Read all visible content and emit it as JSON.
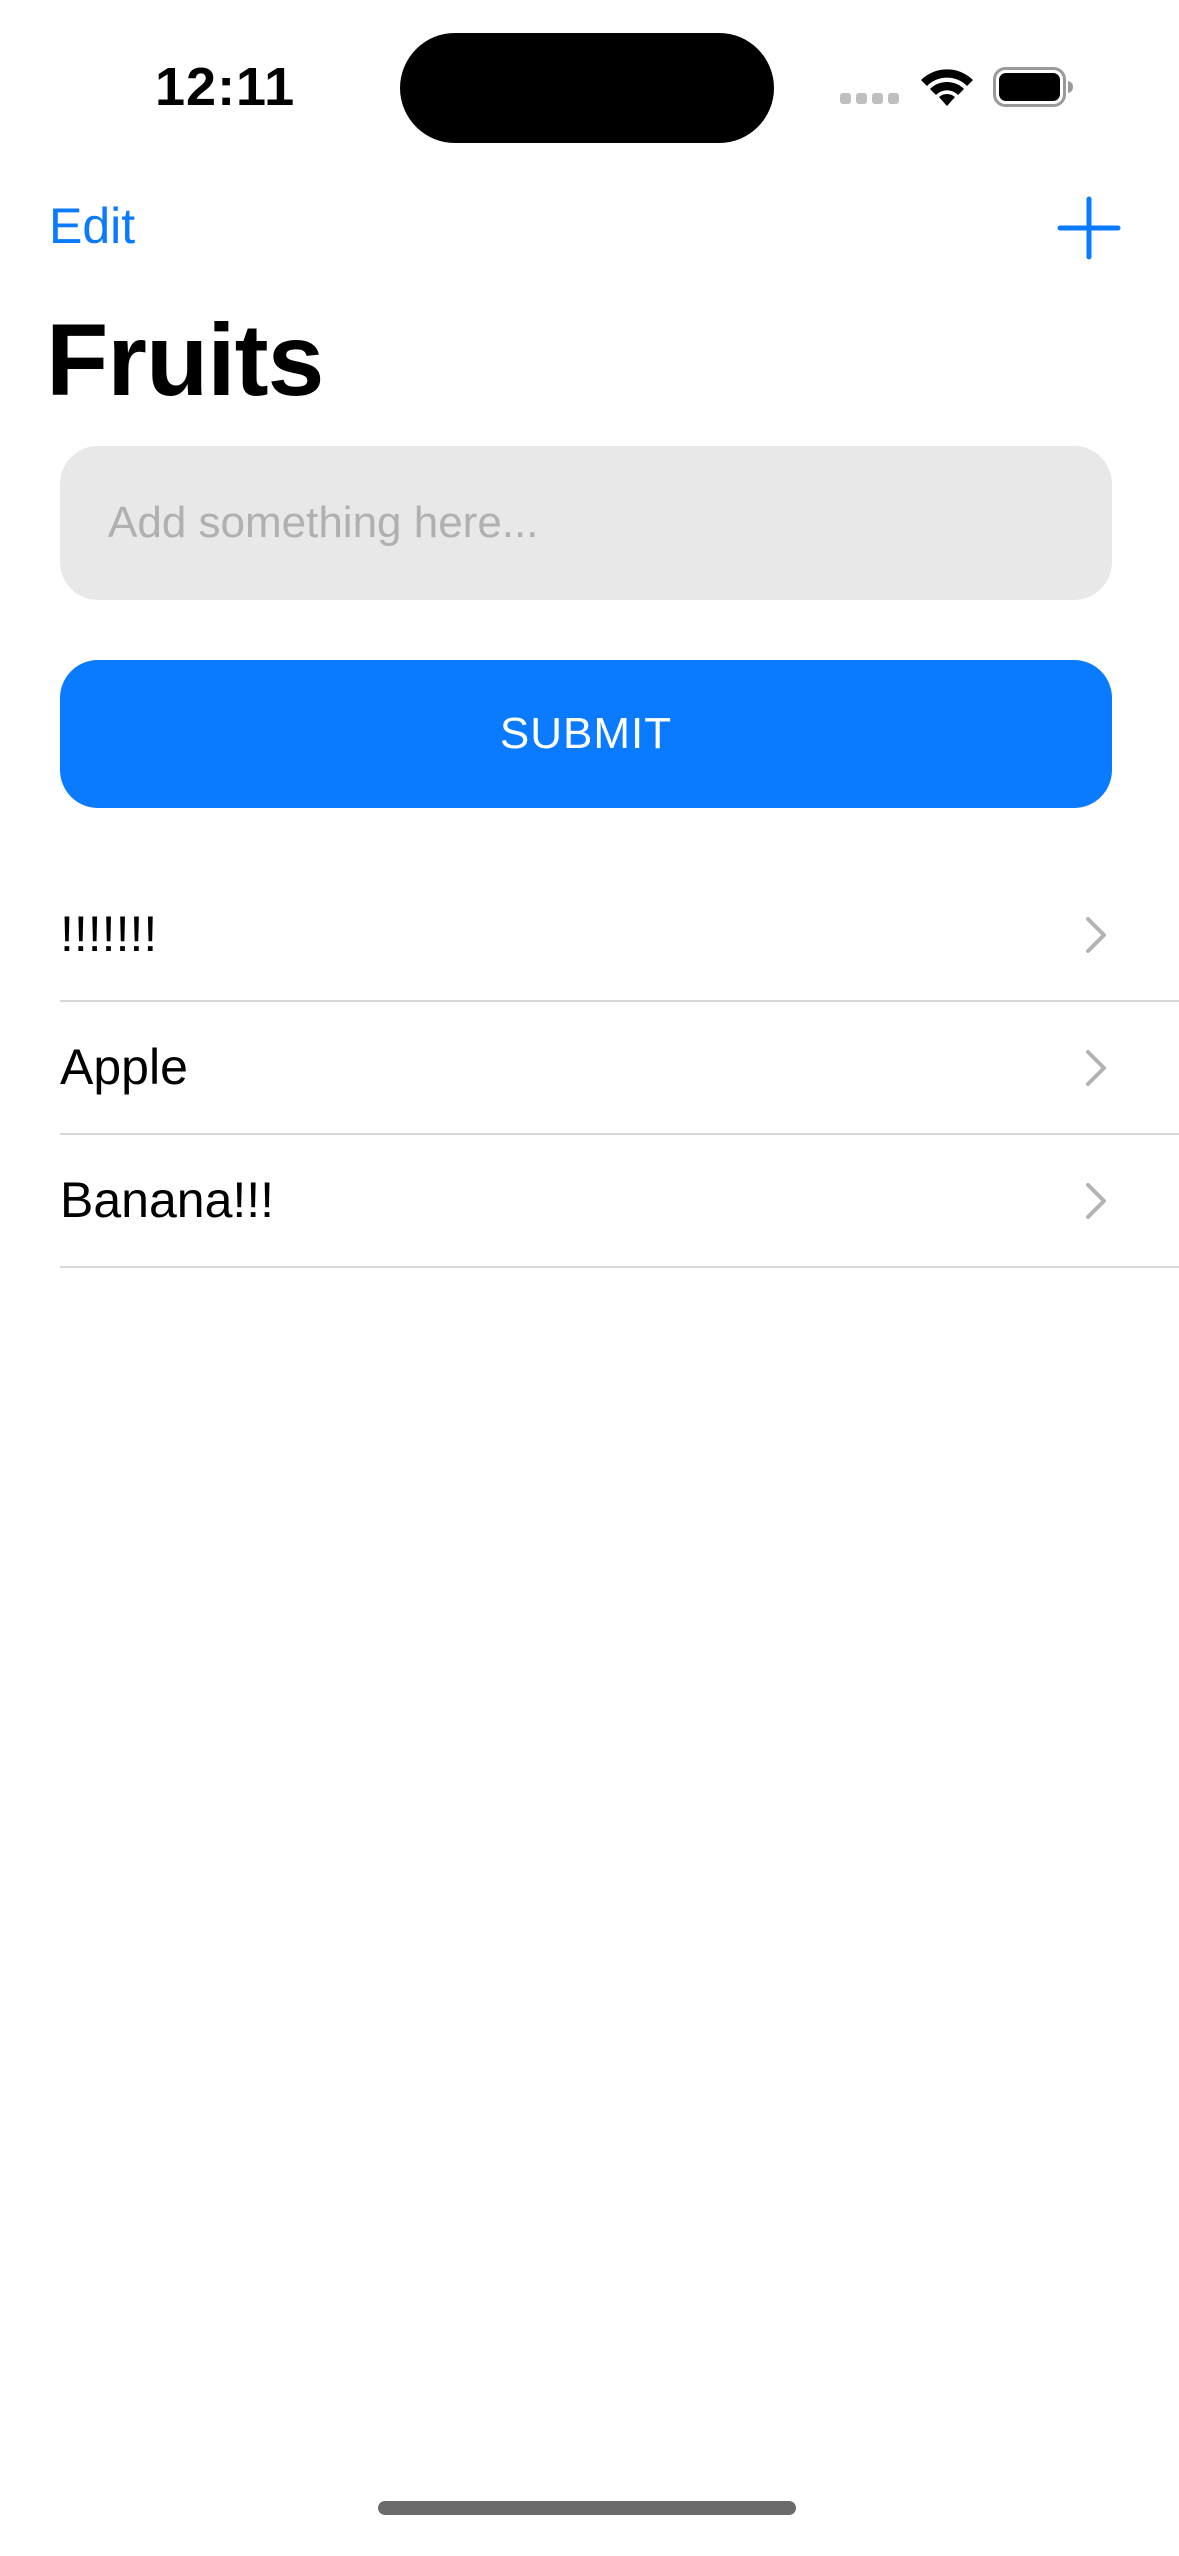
{
  "status_bar": {
    "time": "12:11",
    "icons": [
      "cellular-signal-icon",
      "wifi-icon",
      "battery-icon"
    ]
  },
  "nav": {
    "edit_label": "Edit",
    "add_icon": "plus-icon"
  },
  "page": {
    "title": "Fruits"
  },
  "form": {
    "input_placeholder": "Add something here...",
    "input_value": "",
    "submit_label": "SUBMIT"
  },
  "list": {
    "items": [
      {
        "label": "!!!!!!!"
      },
      {
        "label": "Apple"
      },
      {
        "label": "Banana!!!"
      }
    ],
    "chevron_icon": "chevron-right-icon"
  },
  "colors": {
    "accent": "#0a7aff",
    "input_background": "#e8e8e8",
    "placeholder": "#b0b0b0",
    "separator": "#d8d8d8",
    "chevron": "#b3b3b3"
  }
}
